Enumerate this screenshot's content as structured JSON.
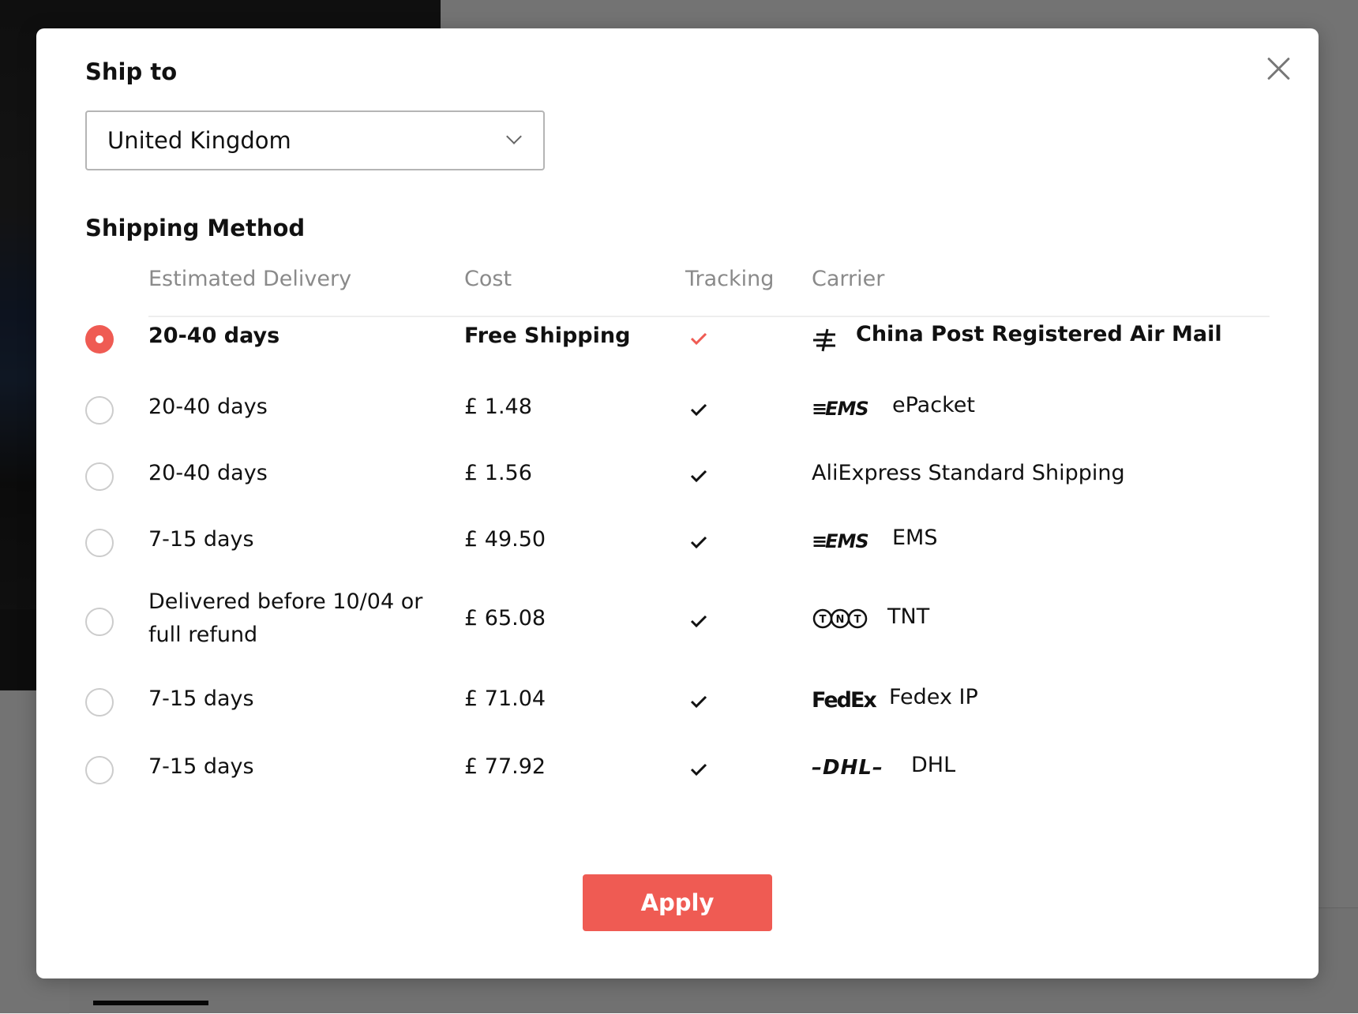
{
  "modal": {
    "ship_to_label": "Ship to",
    "country": "United Kingdom",
    "method_label": "Shipping Method",
    "columns": {
      "delivery": "Estimated Delivery",
      "cost": "Cost",
      "tracking": "Tracking",
      "carrier": "Carrier"
    },
    "apply_label": "Apply",
    "accent_color": "#ef5b53"
  },
  "methods": [
    {
      "delivery": "20-40 days",
      "cost": "Free Shipping",
      "tracking": true,
      "carrier": "China Post Registered Air Mail",
      "carrier_icon": "china-post-icon",
      "selected": true
    },
    {
      "delivery": "20-40 days",
      "cost": "£ 1.48",
      "tracking": true,
      "carrier": "ePacket",
      "carrier_icon": "ems-logo-icon",
      "logo_text": "EMS",
      "selected": false
    },
    {
      "delivery": "20-40 days",
      "cost": "£ 1.56",
      "tracking": true,
      "carrier": "AliExpress Standard Shipping",
      "carrier_icon": "",
      "selected": false
    },
    {
      "delivery": "7-15 days",
      "cost": "£ 49.50",
      "tracking": true,
      "carrier": "EMS",
      "carrier_icon": "ems-logo-icon",
      "logo_text": "EMS",
      "selected": false
    },
    {
      "delivery": "Delivered before 10/04 or full refund",
      "cost": "£ 65.08",
      "tracking": true,
      "carrier": "TNT",
      "carrier_icon": "tnt-logo-icon",
      "selected": false
    },
    {
      "delivery": "7-15 days",
      "cost": "£ 71.04",
      "tracking": true,
      "carrier": "Fedex IP",
      "carrier_icon": "fedex-logo-icon",
      "logo_text": "FedEx",
      "selected": false
    },
    {
      "delivery": "7-15 days",
      "cost": "£ 77.92",
      "tracking": true,
      "carrier": "DHL",
      "carrier_icon": "dhl-logo-icon",
      "logo_text": "DHL",
      "selected": false
    }
  ]
}
